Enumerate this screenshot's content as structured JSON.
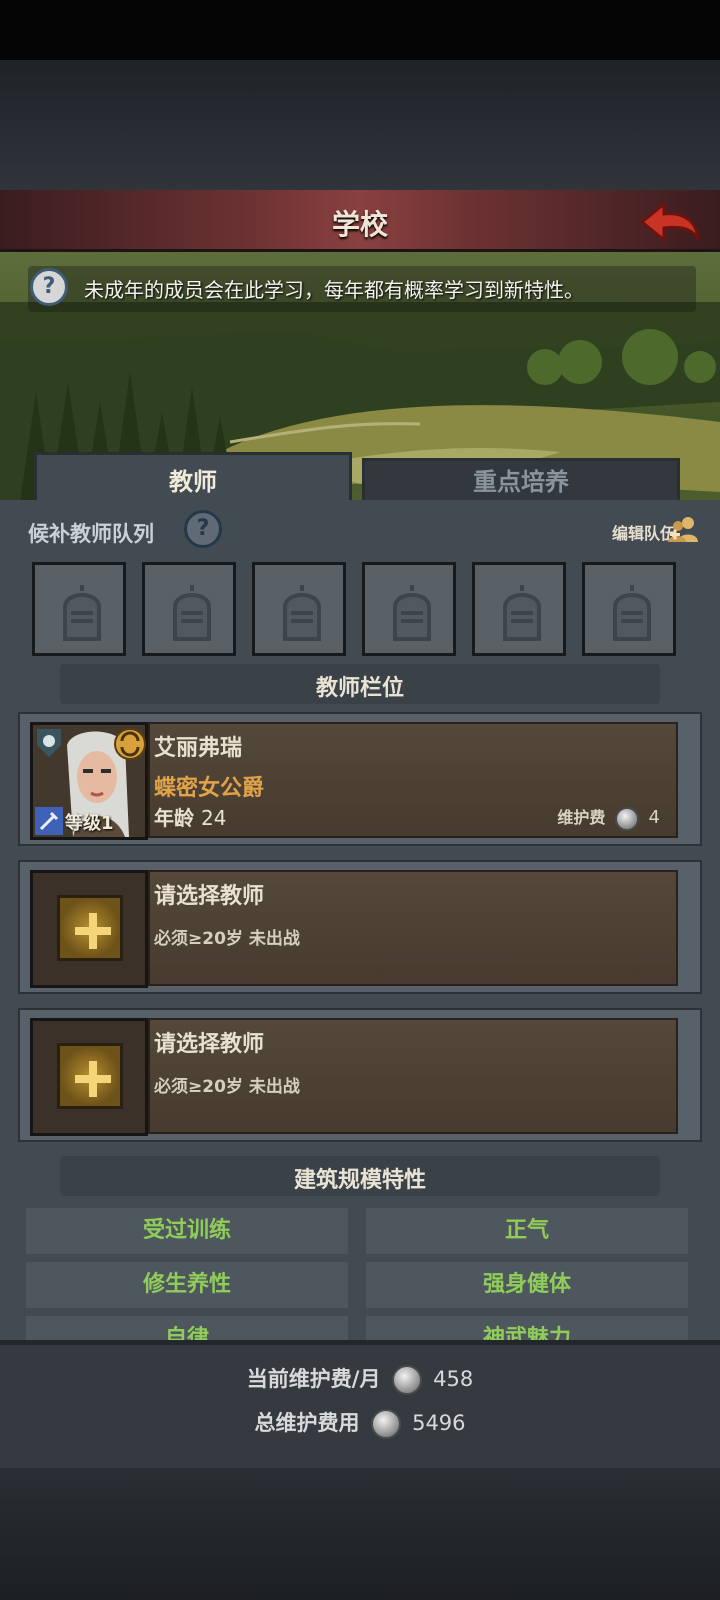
{
  "header": {
    "title": "学校"
  },
  "info": {
    "text": "未成年的成员会在此学习，每年都有概率学习到新特性。"
  },
  "tabs": [
    {
      "label": "教师",
      "active": true
    },
    {
      "label": "重点培养",
      "active": false
    }
  ],
  "queue": {
    "title": "候补教师队列",
    "edit_label": "编辑队伍",
    "slot_count": 6
  },
  "teacher_section": {
    "title": "教师栏位"
  },
  "teachers": [
    {
      "name": "艾丽弗瑞",
      "title": "蝶密女公爵",
      "level_label": "等级1",
      "age_label": "年龄",
      "age": "24",
      "upkeep_label": "维护费",
      "upkeep": "4"
    }
  ],
  "empty_slots": [
    {
      "label": "请选择教师",
      "requirement": "必须≥20岁 未出战"
    },
    {
      "label": "请选择教师",
      "requirement": "必须≥20岁 未出战"
    }
  ],
  "traits_section": {
    "title": "建筑规模特性"
  },
  "traits": [
    "受过训练",
    "正气",
    "修生养性",
    "强身健体",
    "自律",
    "神武魅力"
  ],
  "footer": {
    "monthly_label": "当前维护费/月",
    "monthly_value": "458",
    "total_label": "总维护费用",
    "total_value": "5496"
  },
  "colors": {
    "trait_text": "#8fcc5a",
    "title_orange": "#e0a34a",
    "header_red": "#8a4040"
  }
}
